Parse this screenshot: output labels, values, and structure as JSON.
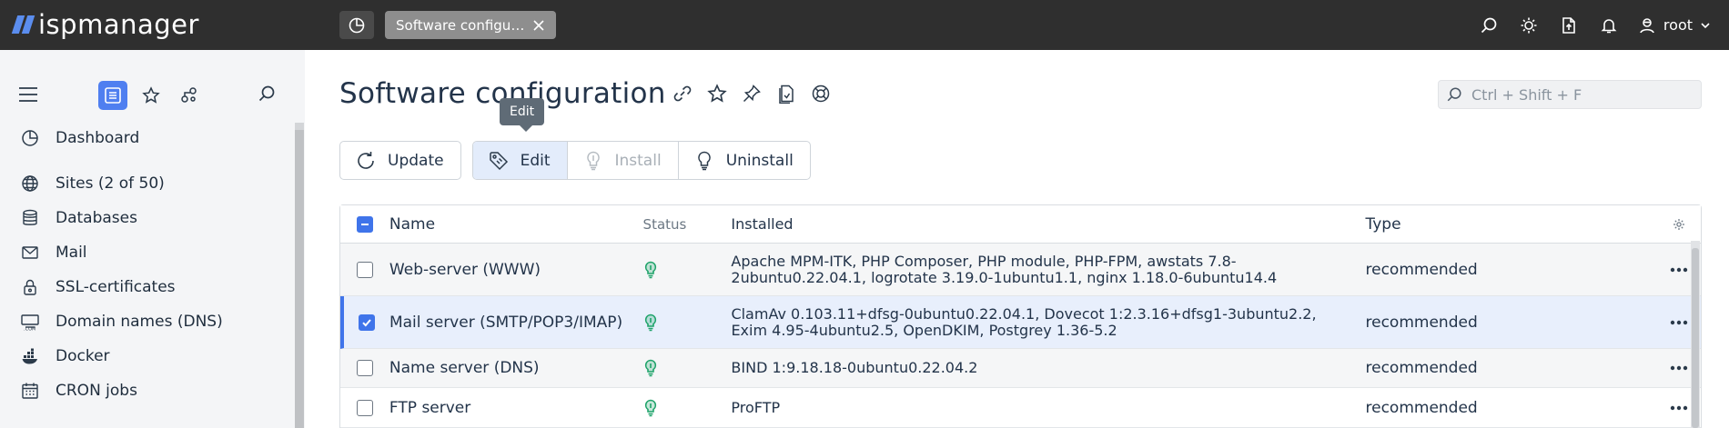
{
  "app": {
    "logo_text": "ispmanager",
    "open_tab": "Software configuration",
    "user_name": "root"
  },
  "sidebar": {
    "items": [
      {
        "label": "Dashboard",
        "icon": "dashboard-icon"
      },
      {
        "label": "Sites (2 of 50)",
        "icon": "globe-icon"
      },
      {
        "label": "Databases",
        "icon": "database-icon"
      },
      {
        "label": "Mail",
        "icon": "mail-icon"
      },
      {
        "label": "SSL-certificates",
        "icon": "lock-icon"
      },
      {
        "label": "Domain names (DNS)",
        "icon": "domain-icon"
      },
      {
        "label": "Docker",
        "icon": "docker-icon"
      },
      {
        "label": "CRON jobs",
        "icon": "calendar-icon"
      }
    ]
  },
  "page": {
    "title": "Software configuration",
    "tooltip": "Edit",
    "search_placeholder": "Ctrl + Shift + F"
  },
  "toolbar": {
    "update": "Update",
    "edit": "Edit",
    "install": "Install",
    "uninstall": "Uninstall"
  },
  "table": {
    "columns": {
      "name": "Name",
      "status": "Status",
      "installed": "Installed",
      "type": "Type"
    },
    "rows": [
      {
        "name": "Web-server (WWW)",
        "installed": "Apache MPM-ITK, PHP Composer, PHP module, PHP-FPM, awstats 7.8-2ubuntu0.22.04.1, logrotate 3.19.0-1ubuntu1.1, nginx 1.18.0-6ubuntu14.4",
        "type": "recommended",
        "checked": false
      },
      {
        "name": "Mail server (SMTP/POP3/IMAP)",
        "installed": "ClamAv 0.103.11+dfsg-0ubuntu0.22.04.1, Dovecot 1:2.3.16+dfsg1-3ubuntu2.2, Exim 4.95-4ubuntu2.5, OpenDKIM, Postgrey 1.36-5.2",
        "type": "recommended",
        "checked": true
      },
      {
        "name": "Name server (DNS)",
        "installed": "BIND 1:9.18.18-0ubuntu0.22.04.2",
        "type": "recommended",
        "checked": false
      },
      {
        "name": "FTP server",
        "installed": "ProFTP",
        "type": "recommended",
        "checked": false
      }
    ]
  },
  "colors": {
    "topbar": "#2f2f2f",
    "accent": "#3f74ea",
    "status_ok": "#1fa36a"
  }
}
